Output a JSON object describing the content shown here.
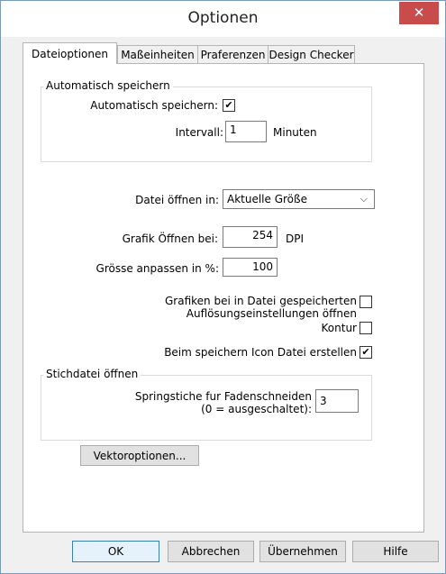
{
  "window": {
    "title": "Optionen",
    "close_glyph": "✕"
  },
  "tabs": [
    {
      "label": "Dateioptionen",
      "active": true
    },
    {
      "label": "Maßeinheiten",
      "active": false
    },
    {
      "label": "Praferenzen",
      "active": false
    },
    {
      "label": "Design Checker",
      "active": false
    }
  ],
  "autosave": {
    "group_label": "Automatisch speichern",
    "checkbox_label": "Automatisch speichern:",
    "checked": true,
    "interval_label": "Intervall:",
    "interval_value": "1",
    "interval_unit": "Minuten"
  },
  "open_file": {
    "label": "Datei öffnen in:",
    "selected": "Aktuelle Größe"
  },
  "graphic_open": {
    "label": "Grafik Öffnen bei:",
    "value": "254",
    "unit": "DPI"
  },
  "resize": {
    "label": "Grösse anpassen in %:",
    "value": "100"
  },
  "graphics_saved": {
    "label_line1": "Grafiken bei in Datei gespeicherten",
    "label_line2": "Auflösungseinstellungen öffnen",
    "checked": false
  },
  "contour": {
    "label": "Kontur",
    "checked": false
  },
  "icon_file": {
    "label": "Beim speichern Icon Datei erstellen",
    "checked": true
  },
  "stitch": {
    "group_label": "Stichdatei öffnen",
    "label_line1": "Springstiche fur Fadenschneiden",
    "label_line2": "(0 = ausgeschaltet):",
    "value": "3"
  },
  "vector_button": "Vektoroptionen...",
  "footer": {
    "ok": "OK",
    "cancel": "Abbrechen",
    "apply": "Übernehmen",
    "help": "Hilfe"
  },
  "checkmark_glyph": "✔",
  "colors": {
    "close_button": "#c94c4c",
    "default_button_border": "#3c7fb1"
  }
}
